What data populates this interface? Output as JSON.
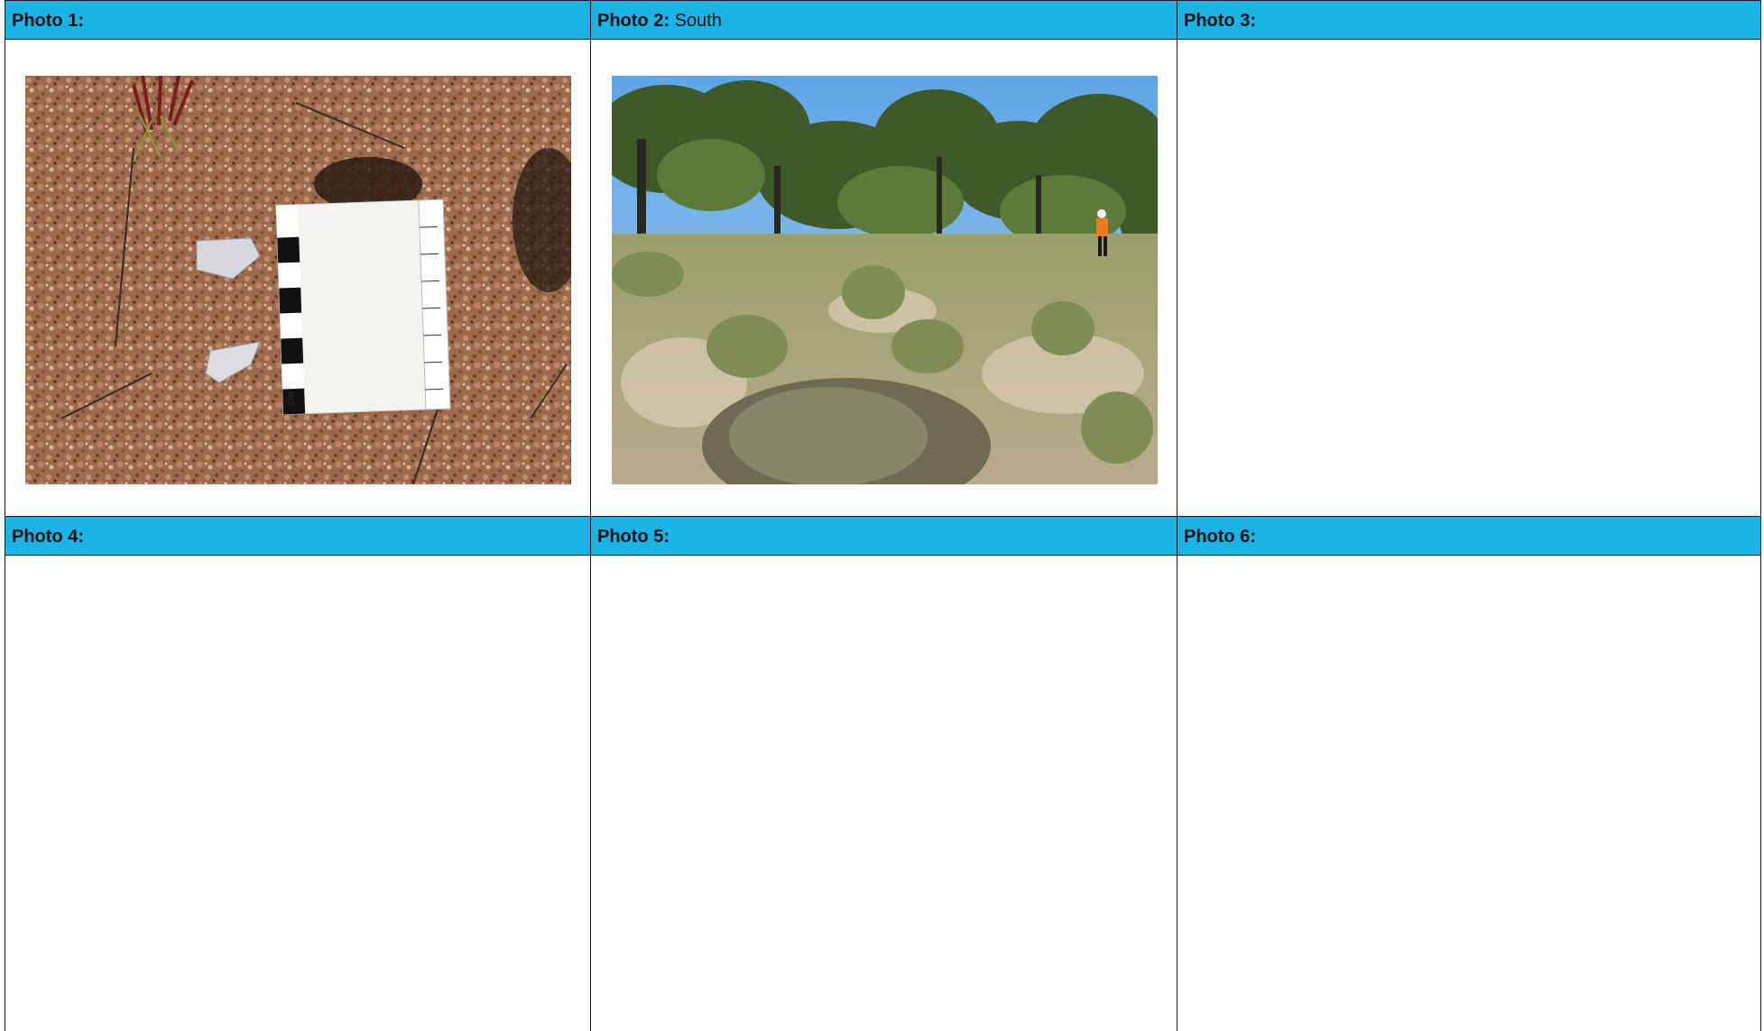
{
  "cells": [
    {
      "label": "Photo 1:",
      "caption": ""
    },
    {
      "label": "Photo 2:",
      "caption": "South"
    },
    {
      "label": "Photo 3:",
      "caption": ""
    },
    {
      "label": "Photo 4:",
      "caption": ""
    },
    {
      "label": "Photo 5:",
      "caption": ""
    },
    {
      "label": "Photo 6:",
      "caption": ""
    }
  ],
  "photos": {
    "photo1": {
      "subject": "artefacts-with-scale-ruler",
      "scale_unit": "cm"
    },
    "photo2": {
      "subject": "open-woodland-grassland-with-person"
    }
  },
  "colors": {
    "header_bg": "#1bb2e6",
    "border": "#1a1a1a"
  }
}
